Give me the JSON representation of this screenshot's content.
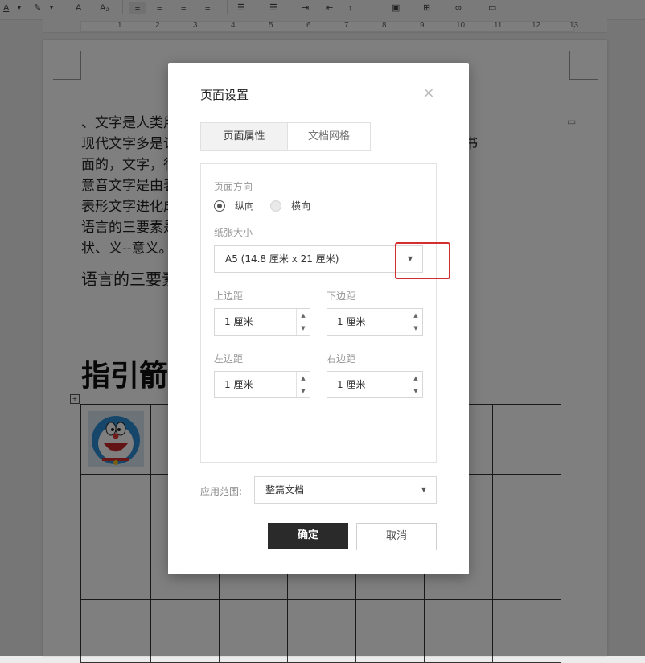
{
  "toolbar": {
    "items": [
      "A",
      "A⁺",
      "A₂"
    ]
  },
  "ruler": {
    "ticks": [
      "1",
      "2",
      "3",
      "4",
      "5",
      "6",
      "7",
      "8",
      "9",
      "10",
      "11",
      "12",
      "13"
    ]
  },
  "document": {
    "lines": [
      "、文字是人类用符号记录表达信息以传之久远的方式和工具。",
      "现代文字多是记录语言的工具。人类往往先有口头的语言后产生书",
      "面的，文字，很多小语种，有语言但没有文字。汉",
      "意音文字是由表意文字和表音文字组成的拼音文字，汉字是由",
      "表形文字进化成的表意文字。",
      "语言的三要素是：音、形、义。其中，音--字音、--字 符形",
      "状、义--意义。"
    ],
    "line8": "语言的三要素是：音、形、义。汉字的三要素是：音",
    "heading": "指引箭头"
  },
  "dialog": {
    "title": "页面设置",
    "close": "×",
    "tabs": [
      {
        "label": "页面属性",
        "active": true
      },
      {
        "label": "文档网格",
        "active": false
      }
    ],
    "orientation": {
      "label": "页面方向",
      "options": [
        "纵向",
        "横向"
      ],
      "selected": "纵向"
    },
    "paper": {
      "label": "纸张大小",
      "value": "A5 (14.8 厘米 x 21 厘米)"
    },
    "margins": {
      "top_label": "上边距",
      "top_value": "1 厘米",
      "bottom_label": "下边距",
      "bottom_value": "1 厘米",
      "left_label": "左边距",
      "left_value": "1 厘米",
      "right_label": "右边距",
      "right_value": "1 厘米"
    },
    "apply": {
      "label": "应用范围:",
      "value": "整篇文档"
    },
    "ok": "确定",
    "cancel": "取消"
  },
  "colors": {
    "highlight": "#d32f2f",
    "primary_button": "#2a2a2a"
  }
}
